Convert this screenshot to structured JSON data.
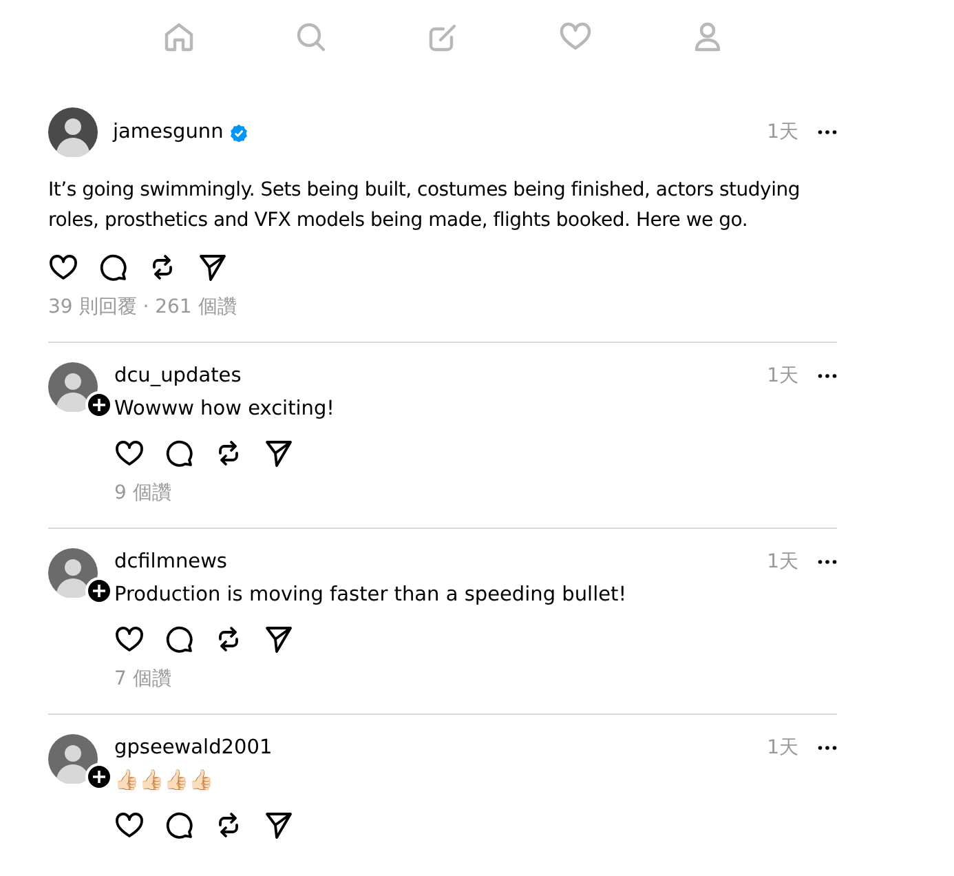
{
  "nav": [
    {
      "kind": "home"
    },
    {
      "kind": "search"
    },
    {
      "kind": "compose"
    },
    {
      "kind": "activity"
    },
    {
      "kind": "profile"
    }
  ],
  "post": {
    "username": "jamesgunn",
    "verified": true,
    "time": "1天",
    "text": "It’s going swimmingly. Sets being built, costumes being finished, actors studying roles, prosthetics and VFX models being made, flights booked. Here we go.",
    "stats": "39 則回覆 · 261 個讚"
  },
  "replies": [
    {
      "username": "dcu_updates",
      "time": "1天",
      "text": "Wowww how exciting!",
      "stats": "9 個讚"
    },
    {
      "username": "dcfilmnews",
      "time": "1天",
      "text": "Production is moving faster than a speeding bullet!",
      "stats": "7 個讚"
    },
    {
      "username": "gpseewald2001",
      "time": "1天",
      "text": "👍🏻👍🏻👍🏻👍🏻"
    }
  ]
}
